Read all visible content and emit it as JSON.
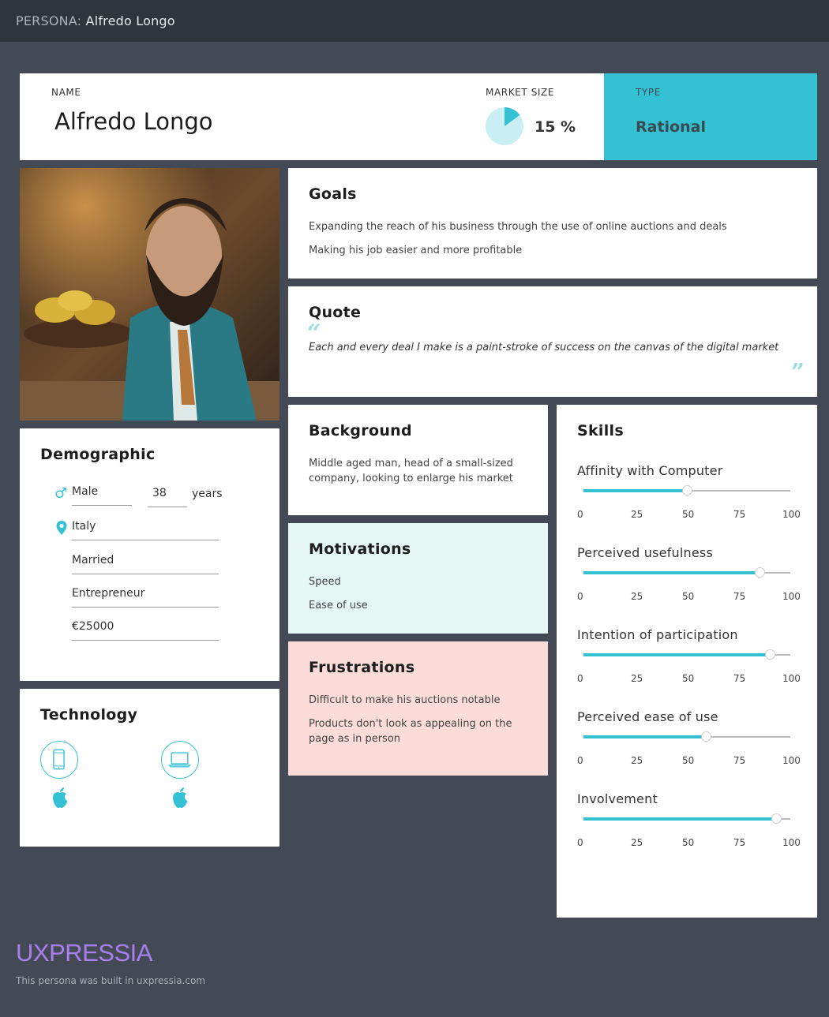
{
  "topbar": {
    "prefix": "PERSONA:",
    "name": "Alfredo Longo"
  },
  "header": {
    "name_label": "NAME",
    "name": "Alfredo Longo",
    "market_size_label": "MARKET SIZE",
    "market_size": "15 %",
    "market_size_fraction": 0.15,
    "type_label": "TYPE",
    "type": "Rational"
  },
  "colors": {
    "accent": "#35c1d4",
    "background": "#444a55",
    "topbar": "#2f343d",
    "motivations": "#e5f7f4",
    "frustrations": "#fbdcd8",
    "brand": "#a97ff0"
  },
  "goals": {
    "title": "Goals",
    "items": [
      "Expanding the reach of his business through the use of online auctions and deals",
      "Making his job easier and more profitable"
    ]
  },
  "quote": {
    "title": "Quote",
    "open_mark": "“",
    "close_mark": "”",
    "text": "Each and every deal I make is a paint-stroke of success on the canvas of the digital market"
  },
  "demographic": {
    "title": "Demographic",
    "gender_icon": "male-icon",
    "gender": "Male",
    "age": "38",
    "age_unit": "years",
    "location_icon": "location-pin-icon",
    "location": "Italy",
    "status": "Married",
    "occupation": "Entrepreneur",
    "income": "€25000"
  },
  "technology": {
    "title": "Technology",
    "devices": [
      {
        "icon": "smartphone-icon",
        "os_icon": "apple-icon"
      },
      {
        "icon": "laptop-icon",
        "os_icon": "apple-icon"
      }
    ]
  },
  "background": {
    "title": "Background",
    "text": "Middle aged man, head of a small-sized company, looking to enlarge his market"
  },
  "motivations": {
    "title": "Motivations",
    "items": [
      "Speed",
      "Ease of use"
    ]
  },
  "frustrations": {
    "title": "Frustrations",
    "items": [
      "Difficult to make his auctions notable",
      "Products don't look as appealing on the page as in person"
    ]
  },
  "skills": {
    "title": "Skills",
    "ticks": [
      "0",
      "25",
      "50",
      "75",
      "100"
    ],
    "items": [
      {
        "name": "Affinity with Computer",
        "value": 50
      },
      {
        "name": "Perceived usefulness",
        "value": 85
      },
      {
        "name": "Intention of participation",
        "value": 90
      },
      {
        "name": "Perceived ease of use",
        "value": 59
      },
      {
        "name": "Involvement",
        "value": 93
      }
    ]
  },
  "footer": {
    "brand": "UXPRESSIA",
    "note": "This persona was built in uxpressia.com"
  }
}
